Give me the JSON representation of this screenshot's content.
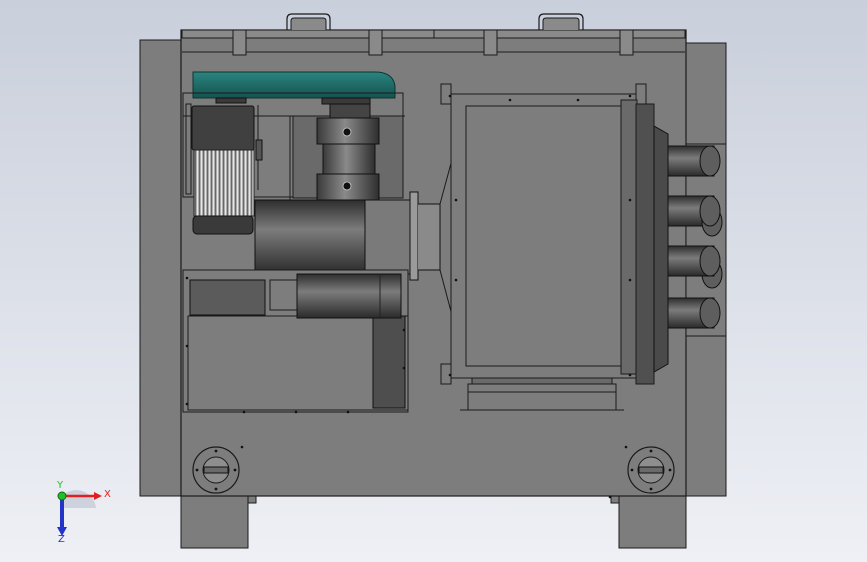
{
  "viewport": {
    "background_top": "#c9cfdb",
    "background_bottom": "#eef0f5"
  },
  "triad": {
    "x_label": "X",
    "y_label": "Y",
    "z_label": "Z",
    "x_color": "#e02020",
    "y_color": "#1fbf2a",
    "z_color": "#2433c8"
  },
  "colors": {
    "body": "#7d7d7d",
    "line": "#1a1a1a",
    "belt_guard": "#1e6e6a",
    "motor": "#3a3a3a",
    "pipe": "#4b4b4b"
  }
}
